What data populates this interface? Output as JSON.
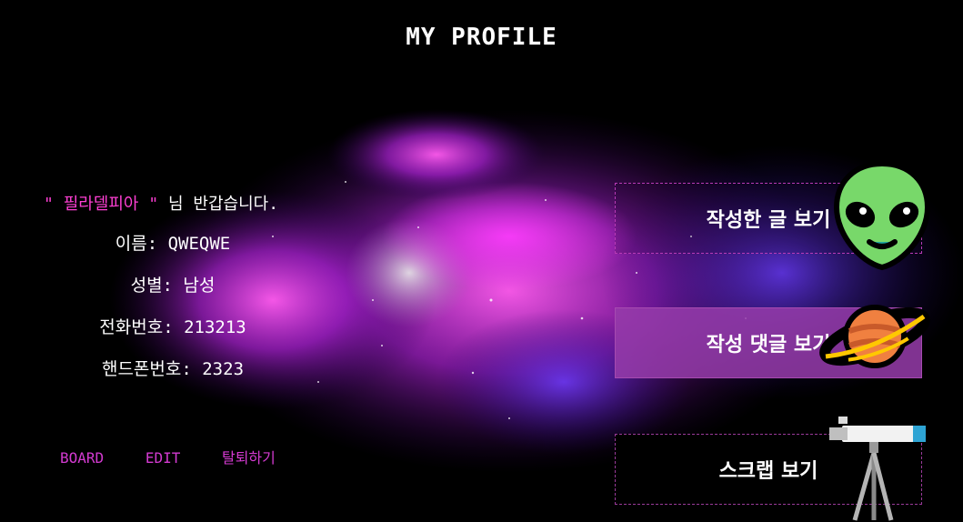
{
  "header": {
    "title": "MY PROFILE"
  },
  "profile": {
    "quote_open": "\"",
    "nickname": "필라델피아",
    "quote_close": "\"",
    "greeting_suffix": "님 반갑습니다.",
    "name_line": "이름: QWEQWE",
    "gender_line": "성별: 남성",
    "phone_line": "전화번호: 213213",
    "mobile_line": "핸드폰번호: 2323"
  },
  "links": {
    "board": "BOARD",
    "edit": "EDIT",
    "withdraw": "탈퇴하기"
  },
  "buttons": {
    "my_posts": "작성한 글 보기",
    "my_comments": "작성 댓글 보기",
    "scrap": "스크랩 보기"
  },
  "icons": {
    "alien": "alien-icon",
    "planet": "ringed-planet-icon",
    "telescope": "telescope-icon"
  },
  "colors": {
    "accent_pink": "#ff3fd4",
    "link": "#d33ad0",
    "button_fill": "#9a3cab"
  }
}
